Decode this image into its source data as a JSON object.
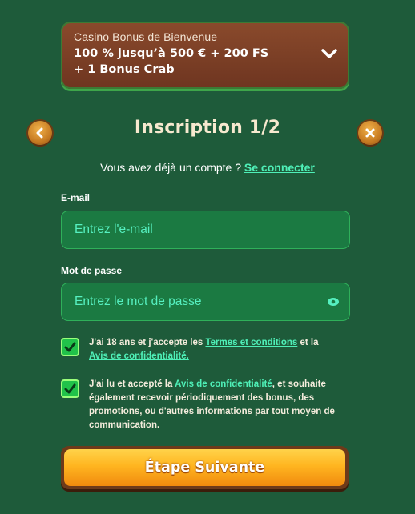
{
  "bonus": {
    "subtitle": "Casino Bonus de Bienvenue",
    "main_line1": "100 % jusqu’à 500 € + 200 FS",
    "main_line2": "+ 1 Bonus Crab"
  },
  "header": {
    "title": "Inscription 1/2"
  },
  "login_prompt": {
    "text": "Vous avez déjà un compte ? ",
    "link": "Se connecter"
  },
  "email": {
    "label": "E-mail",
    "placeholder": "Entrez l'e-mail"
  },
  "password": {
    "label": "Mot de passe",
    "placeholder": "Entrez le mot de passe"
  },
  "consent_terms": {
    "checked": true,
    "text_a": "J'ai 18 ans et j'accepte les ",
    "link_terms": "Termes et conditions",
    "text_b": " et la ",
    "link_privacy": "Avis de confidentialité."
  },
  "consent_marketing": {
    "checked": true,
    "text_a": "J'ai lu et accepté la ",
    "link_privacy": "Avis de confidentialité",
    "text_b": ", et souhaite également recevoir périodiquement des bonus, des promotions, ou d'autres informations par tout moyen de communication."
  },
  "next_button": {
    "label": "Étape Suivante"
  },
  "colors": {
    "background": "#1e5b3a",
    "link": "#4ff0b8",
    "field_bg": "#1b7a42",
    "button_orange": "#ffb520",
    "banner_brown": "#7a3f25"
  },
  "icons": {
    "chevron": "chevron-down-icon",
    "back": "chevron-left-icon",
    "close": "close-icon",
    "eye": "eye-icon",
    "check": "checkmark-icon"
  }
}
